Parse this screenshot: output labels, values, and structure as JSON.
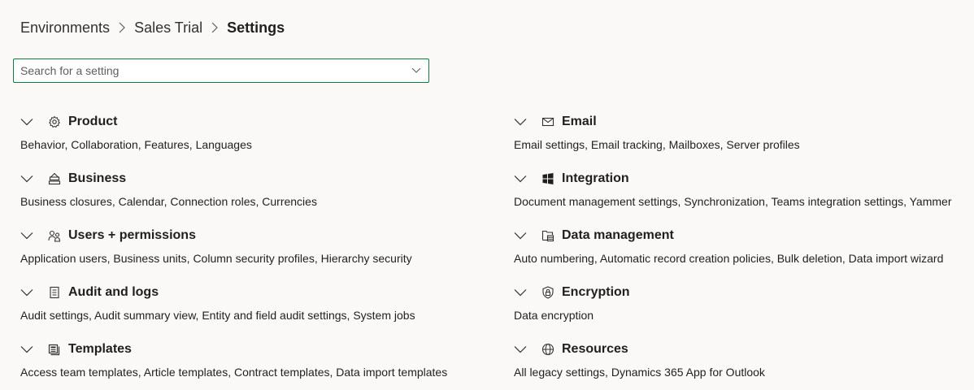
{
  "breadcrumb": {
    "items": [
      "Environments",
      "Sales Trial"
    ],
    "current": "Settings"
  },
  "search": {
    "placeholder": "Search for a setting",
    "value": ""
  },
  "groups": {
    "product": {
      "title": "Product",
      "description": "Behavior, Collaboration, Features, Languages",
      "icon": "gear-icon"
    },
    "business": {
      "title": "Business",
      "description": "Business closures, Calendar, Connection roles, Currencies",
      "icon": "business-icon"
    },
    "users": {
      "title": "Users + permissions",
      "description": "Application users, Business units, Column security profiles, Hierarchy security",
      "icon": "people-icon"
    },
    "audit": {
      "title": "Audit and logs",
      "description": "Audit settings, Audit summary view, Entity and field audit settings, System jobs",
      "icon": "clipboard-icon"
    },
    "templates": {
      "title": "Templates",
      "description": "Access team templates, Article templates, Contract templates, Data import templates",
      "icon": "template-icon"
    },
    "email": {
      "title": "Email",
      "description": "Email settings, Email tracking, Mailboxes, Server profiles",
      "icon": "mail-icon"
    },
    "integration": {
      "title": "Integration",
      "description": "Document management settings, Synchronization, Teams integration settings, Yammer",
      "icon": "windows-icon"
    },
    "data_management": {
      "title": "Data management",
      "description": "Auto numbering, Automatic record creation policies, Bulk deletion, Data import wizard",
      "icon": "database-icon"
    },
    "encryption": {
      "title": "Encryption",
      "description": "Data encryption",
      "icon": "shield-lock-icon"
    },
    "resources": {
      "title": "Resources",
      "description": "All legacy settings, Dynamics 365 App for Outlook",
      "icon": "globe-icon"
    }
  },
  "colors": {
    "accent_border": "#107c41",
    "background": "#faf9f8",
    "text": "#201f1e"
  }
}
